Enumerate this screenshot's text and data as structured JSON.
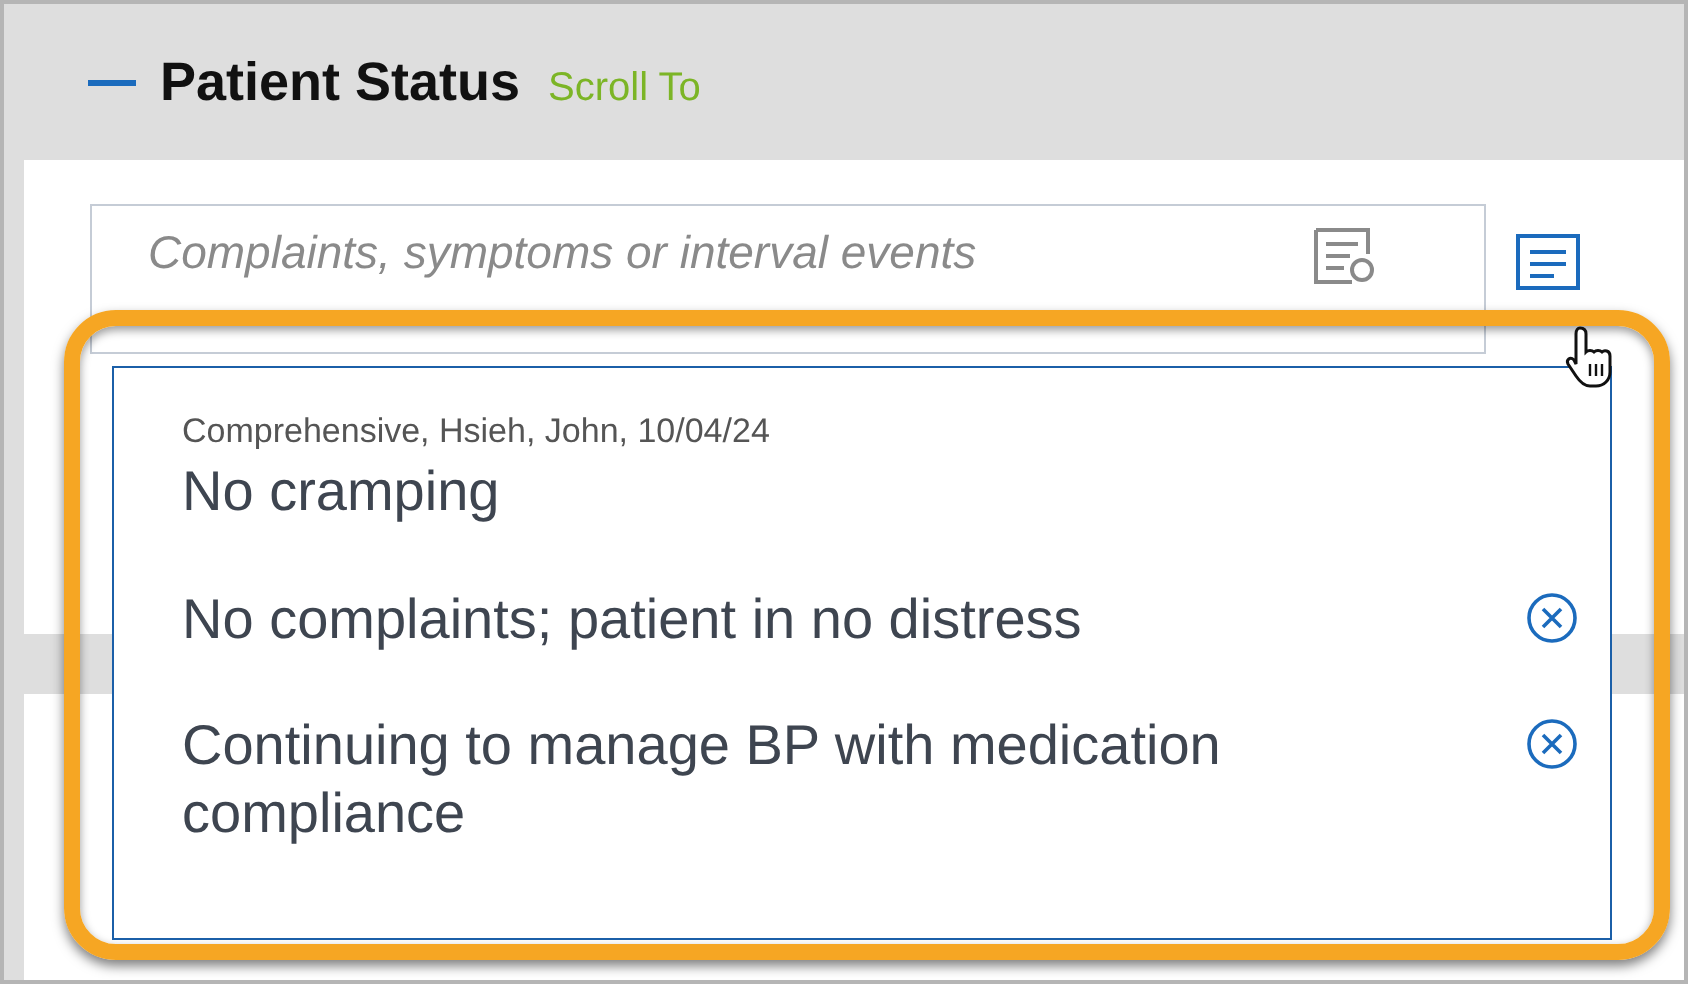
{
  "section": {
    "title": "Patient Status",
    "expanded": true,
    "scroll_link": "Scroll To"
  },
  "complaints_field": {
    "placeholder": "Complaints, symptoms or interval events"
  },
  "suggestions": [
    {
      "meta": "Comprehensive, Hsieh, John, 10/04/24",
      "text": "No cramping",
      "removable": false
    },
    {
      "text": "No complaints; patient in no distress",
      "removable": true
    },
    {
      "text": "Continuing to manage BP with medication compliance",
      "removable": true
    }
  ]
}
